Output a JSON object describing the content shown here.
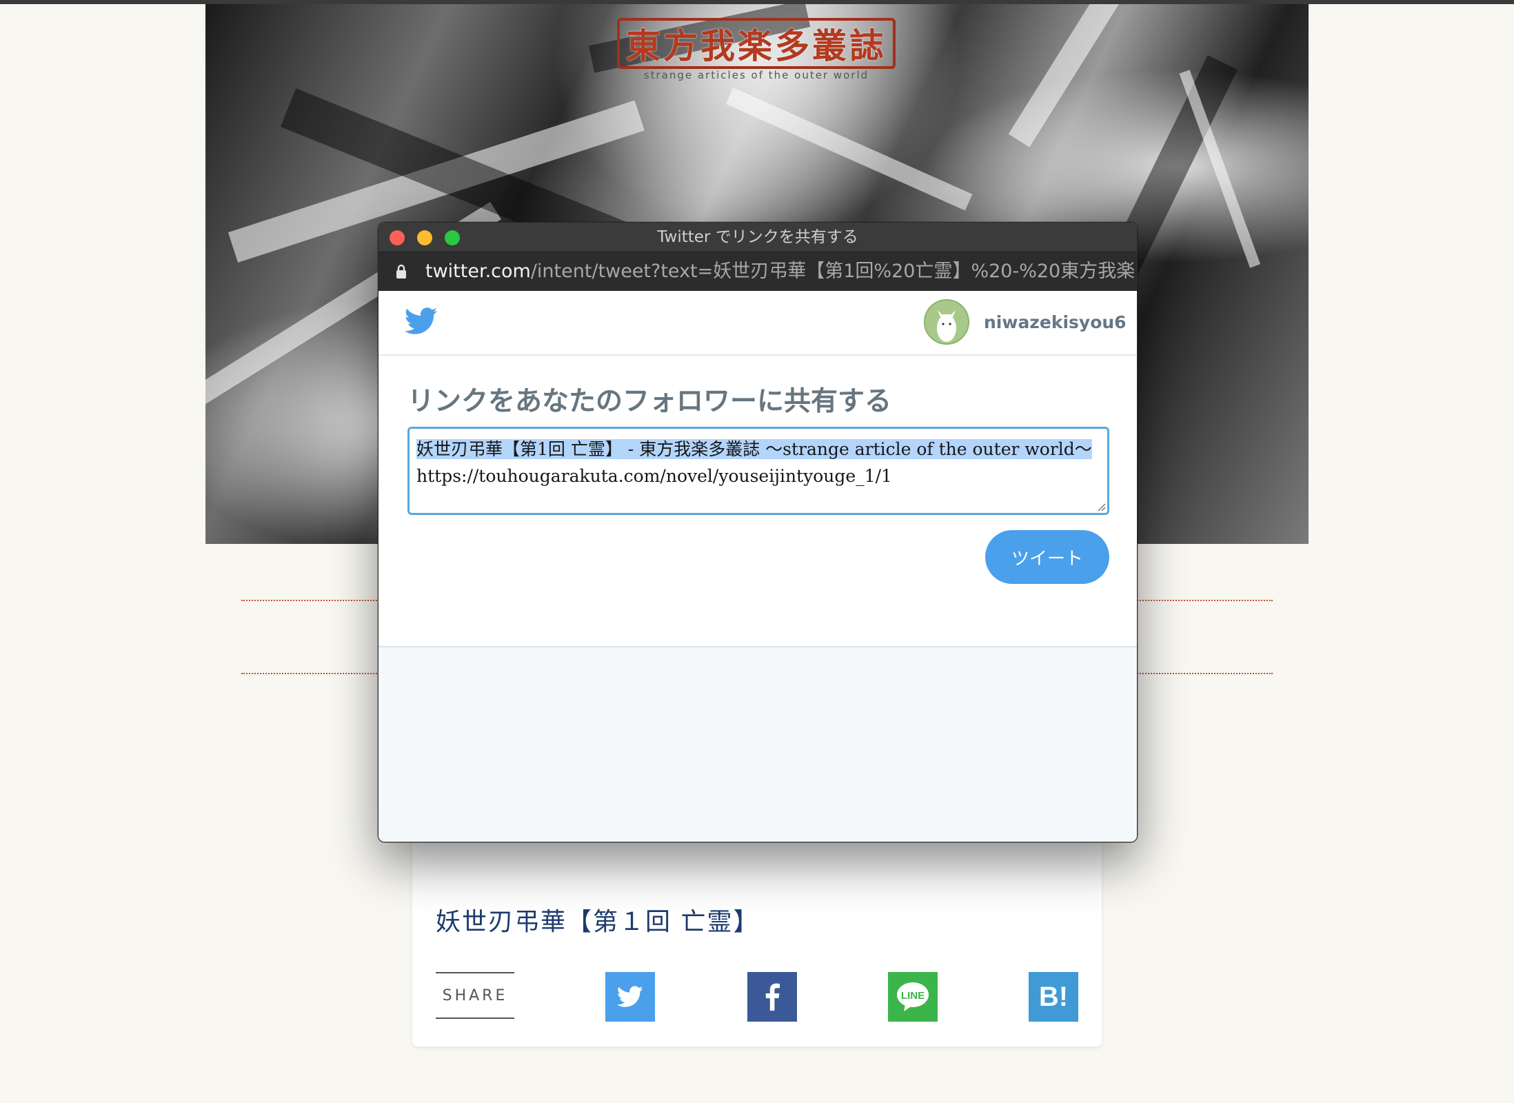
{
  "site": {
    "logo_text": "東方我楽多叢誌",
    "logo_subtitle": "strange articles of the outer world"
  },
  "article": {
    "title": "妖世刃弔華【第１回 亡霊】",
    "share_label": "SHARE",
    "share_buttons": [
      "twitter-icon",
      "facebook-icon",
      "line-icon",
      "hatena-bookmark-icon"
    ],
    "line_text": "LINE",
    "hatena_text": "B!"
  },
  "popup": {
    "window_title": "Twitter でリンクを共有する",
    "url_host": "twitter.com",
    "url_path": "/intent/tweet?text=妖世刃弔華【第1回%20亡霊】%20-%20東方我楽...",
    "username": "niwazekisyou6",
    "heading": "リンクをあなたのフォロワーに共有する",
    "tweet_line1": "妖世刃弔華【第1回 亡霊】 - 東方我楽多叢誌 〜strange article of the outer world〜",
    "tweet_line2": "https://touhougarakuta.com/novel/youseijintyouge_1/1",
    "tweet_button": "ツイート"
  },
  "colors": {
    "twitter_blue": "#4aa0ea",
    "facebook_blue": "#3b5998",
    "line_green": "#3bb54a",
    "hatena_blue": "#3f9ad6",
    "title_navy": "#1c3b6e",
    "logo_red": "#a1301c"
  }
}
